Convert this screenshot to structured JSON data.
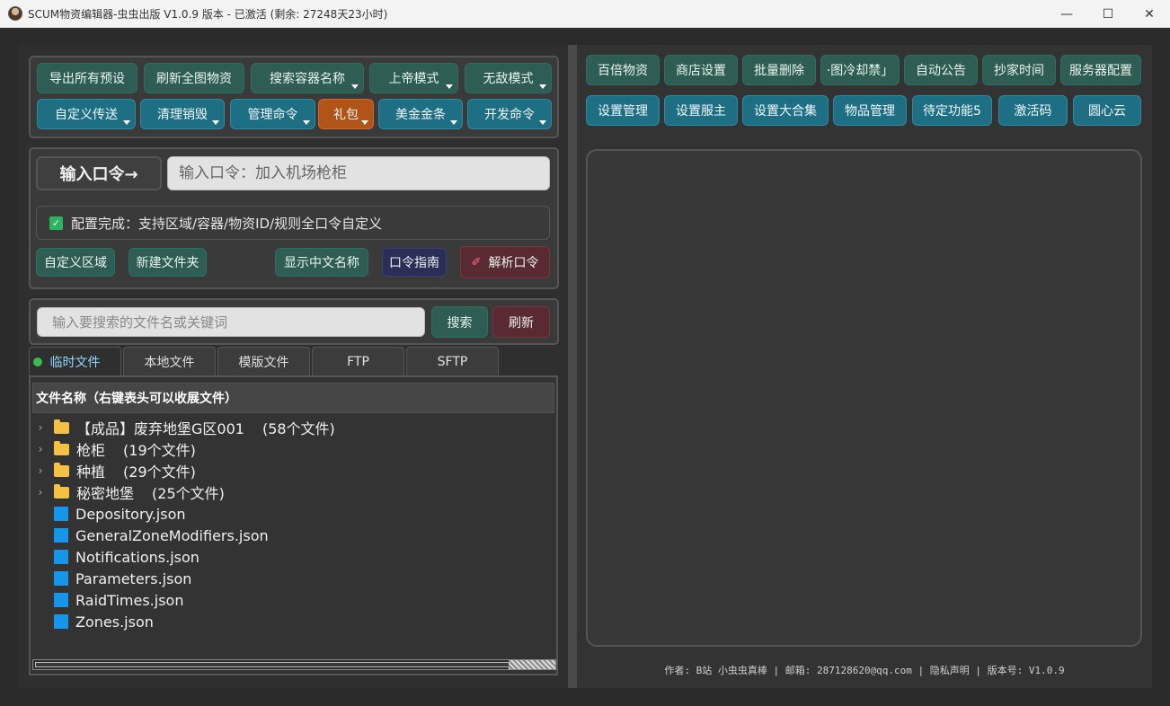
{
  "window": {
    "title": "SCUM物资编辑器-虫虫出版 V1.0.9 版本 - 已激活 (剩余: 27248天23小时)",
    "minimize": "—",
    "maximize": "☐",
    "close": "✕"
  },
  "toolbar": {
    "row1": [
      {
        "label": "导出所有预设",
        "dropdown": false
      },
      {
        "label": "刷新全图物资",
        "dropdown": false
      },
      {
        "label": "搜索容器名称",
        "dropdown": true
      },
      {
        "label": "上帝模式",
        "dropdown": true
      },
      {
        "label": "无敌模式",
        "dropdown": true
      }
    ],
    "row2": [
      {
        "label": "自定义传送",
        "dropdown": true
      },
      {
        "label": "清理销毁",
        "dropdown": true
      },
      {
        "label": "管理命令",
        "dropdown": true
      },
      {
        "label": "礼包",
        "dropdown": true
      },
      {
        "label": "美金金条",
        "dropdown": true
      },
      {
        "label": "开发命令",
        "dropdown": true
      }
    ]
  },
  "command": {
    "label": "输入口令→",
    "placeholder": "输入口令：加入机场枪柜",
    "status": "配置完成：支持区域/容器/物资ID/规则全口令自定义",
    "buttons": {
      "custom_zone": "自定义区域",
      "new_folder": "新建文件夹",
      "show_cn_names": "显示中文名称",
      "guide": "口令指南",
      "parse": "解析口令"
    }
  },
  "file_browser": {
    "search_placeholder": "输入要搜索的文件名或关键词",
    "search_button": "搜索",
    "refresh_button": "刷新",
    "tabs": [
      "临时文件",
      "本地文件",
      "模版文件",
      "FTP",
      "SFTP"
    ],
    "column_header": "文件名称（右键表头可以收展文件）",
    "folders": [
      {
        "name": "【成品】废弃地堡G区001",
        "count": "(58个文件)"
      },
      {
        "name": "枪柜",
        "count": "(19个文件)"
      },
      {
        "name": "种植",
        "count": "(29个文件)"
      },
      {
        "name": "秘密地堡",
        "count": "(25个文件)"
      }
    ],
    "files": [
      "Depository.json",
      "GeneralZoneModifiers.json",
      "Notifications.json",
      "Parameters.json",
      "RaidTimes.json",
      "Zones.json"
    ]
  },
  "right_toolbar": {
    "row1": [
      "百倍物资",
      "商店设置",
      "批量删除",
      "·图冷却禁」",
      "自动公告",
      "抄家时间",
      "服务器配置"
    ],
    "row2": [
      "设置管理",
      "设置服主",
      "设置大合集",
      "物品管理",
      "待定功能5",
      "激活码",
      "圆心云"
    ]
  },
  "footer": "作者: B站 小虫虫真棒 | 邮箱: 287128620@qq.com | 隐私声明 | 版本号: V1.0.9"
}
